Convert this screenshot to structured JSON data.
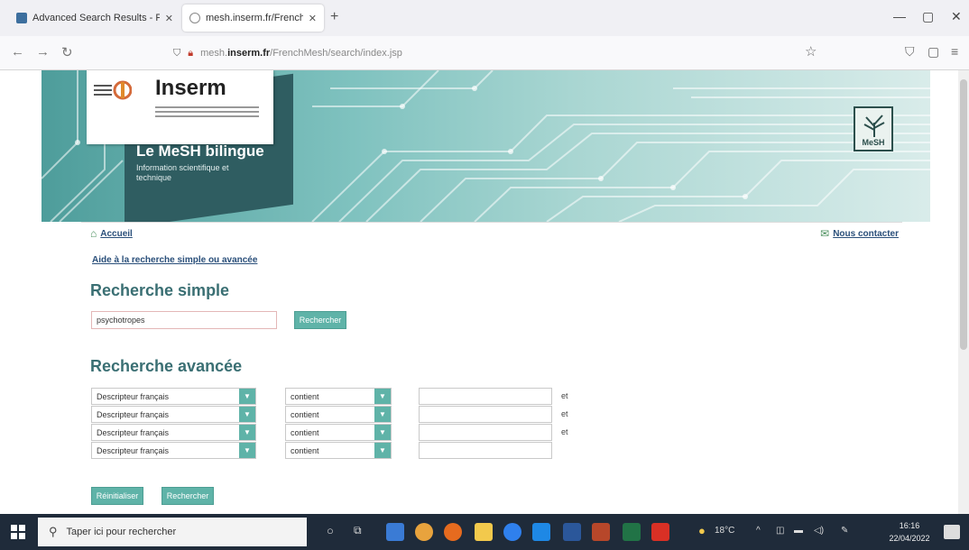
{
  "browser": {
    "tabs": [
      {
        "label": "Advanced Search Results - PubMed",
        "active": false
      },
      {
        "label": "mesh.inserm.fr/FrenchMesh/search/index.jsp",
        "active": true
      }
    ],
    "url_prefix": "mesh.",
    "url_domain": "inserm.fr",
    "url_path": "/FrenchMesh/search/index.jsp"
  },
  "header": {
    "logo_text": "Inserm",
    "title": "Le MeSH bilingue",
    "subtitle": "Information scientifique et technique",
    "badge": "MeSH"
  },
  "nav": {
    "home": "Accueil",
    "contact": "Nous contacter",
    "help": "Aide à la recherche simple ou avancée"
  },
  "simple": {
    "title": "Recherche simple",
    "value": "psychotropes",
    "button": "Rechercher"
  },
  "advanced": {
    "title": "Recherche avancée",
    "rows": [
      {
        "field": "Descripteur français",
        "mode": "contient",
        "op": "et"
      },
      {
        "field": "Descripteur français",
        "mode": "contient",
        "op": "et"
      },
      {
        "field": "Descripteur français",
        "mode": "contient",
        "op": "et"
      },
      {
        "field": "Descripteur français",
        "mode": "contient",
        "op": ""
      }
    ],
    "reset_button": "Réinitialiser",
    "search_button": "Rechercher"
  },
  "taskbar": {
    "search_placeholder": "Taper ici pour rechercher",
    "weather": "18°C",
    "time": "16:16",
    "date": "22/04/2022"
  }
}
